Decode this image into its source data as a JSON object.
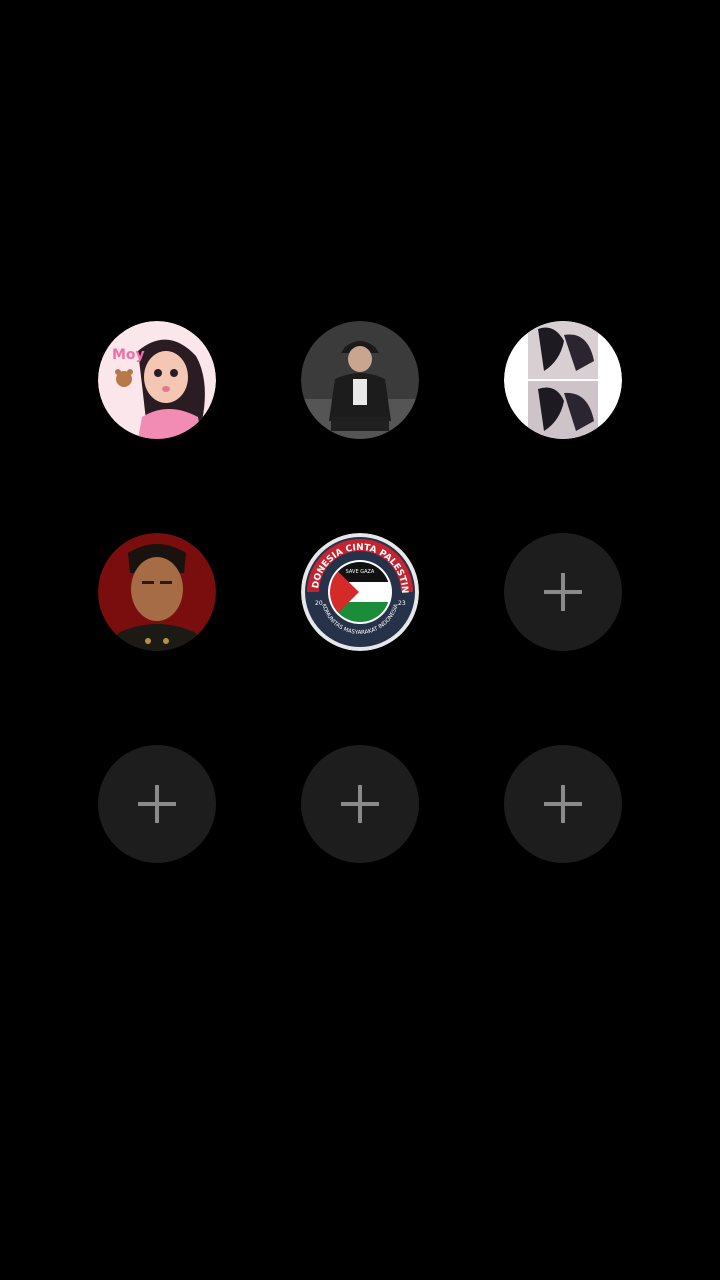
{
  "grid": {
    "slots": [
      {
        "type": "avatar",
        "subject": "cartoon-girl-avatar",
        "badge_text": "Moy"
      },
      {
        "type": "avatar",
        "subject": "man-in-cap-avatar"
      },
      {
        "type": "avatar",
        "subject": "couple-photo-avatar"
      },
      {
        "type": "avatar",
        "subject": "man-portrait-avatar"
      },
      {
        "type": "avatar",
        "subject": "palestine-badge-avatar",
        "badge": {
          "top_text": "INDONESIA CINTA PALESTINE",
          "center_text": "SAVE GAZA",
          "year_left": "20",
          "year_right": "23",
          "bottom_text": "KOMUNITAS MASYARAKAT INDONESIA"
        }
      },
      {
        "type": "add",
        "icon": "plus-icon"
      },
      {
        "type": "add",
        "icon": "plus-icon"
      },
      {
        "type": "add",
        "icon": "plus-icon"
      },
      {
        "type": "add",
        "icon": "plus-icon"
      }
    ]
  },
  "colors": {
    "background": "#000000",
    "empty_slot": "#1d1d1d",
    "plus": "#8a8a8a"
  }
}
